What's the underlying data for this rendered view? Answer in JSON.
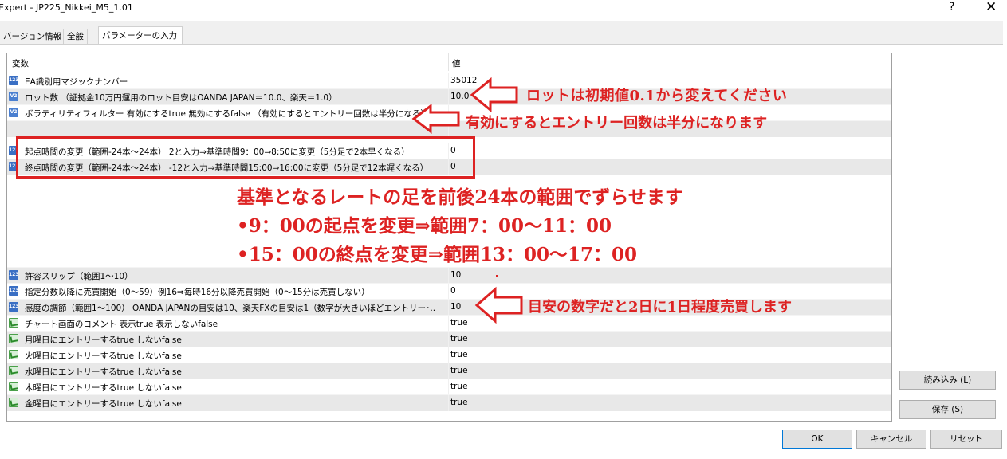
{
  "window": {
    "title": "Expert - JP225_Nikkei_M5_1.01",
    "help": "?",
    "close": "✕"
  },
  "tabs": [
    {
      "label": "バージョン情報"
    },
    {
      "label": "全般"
    },
    {
      "label": "パラメーターの入力"
    }
  ],
  "grid": {
    "headers": {
      "name": "変数",
      "value": "値"
    },
    "rows": [
      {
        "icon": "123",
        "name": "EA識別用マジックナンバー",
        "value": "35012"
      },
      {
        "icon": "V2",
        "name": "ロット数 （証拠金10万円運用のロット目安はOANDA JAPAN＝10.0、楽天＝1.0）",
        "value": "10.0"
      },
      {
        "icon": "V2",
        "name": "ボラティリティフィルター 有効にするtrue 無効にするfalse （有効にするとエントリー回数は半分になる）",
        "value": ""
      },
      {
        "icon": "",
        "name": "",
        "value": ""
      },
      {
        "icon": "123",
        "name": "起点時間の変更（範囲-24本～24本） 2と入力⇒基準時間9：00⇒8:50に変更（5分足で2本早くなる）",
        "value": "0"
      },
      {
        "icon": "123",
        "name": "終点時間の変更（範囲-24本～24本） -12と入力⇒基準時間15:00⇒16:00に変更（5分足で12本遅くなる）",
        "value": "0"
      },
      {
        "icon": "123",
        "name": "許容スリップ（範囲1～10）",
        "value": "10"
      },
      {
        "icon": "123",
        "name": "指定分数以降に売買開始（0～59）例16⇒毎時16分以降売買開始（0～15分は売買しない）",
        "value": "0"
      },
      {
        "icon": "123",
        "name": "感度の調節（範囲1～100） OANDA JAPANの目安は10、楽天FXの目安は1（数字が大きいほどエントリー･..",
        "value": "10"
      },
      {
        "icon": "bool",
        "name": "チャート画面のコメント 表示true 表示しないfalse",
        "value": "true"
      },
      {
        "icon": "bool",
        "name": "月曜日にエントリーするtrue しないfalse",
        "value": "true"
      },
      {
        "icon": "bool",
        "name": "火曜日にエントリーするtrue しないfalse",
        "value": "true"
      },
      {
        "icon": "bool",
        "name": "水曜日にエントリーするtrue しないfalse",
        "value": "true"
      },
      {
        "icon": "bool",
        "name": "木曜日にエントリーするtrue しないfalse",
        "value": "true"
      },
      {
        "icon": "bool",
        "name": "金曜日にエントリーするtrue しないfalse",
        "value": "true"
      }
    ]
  },
  "buttons": {
    "load": "読み込み (L)",
    "save": "保存 (S)",
    "ok": "OK",
    "cancel": "キャンセル",
    "reset": "リセット"
  },
  "annotations": {
    "lot": "ロットは初期値0.1から変えてください",
    "vol": "有効にするとエントリー回数は半分になります",
    "range1": "基準となるレートの足を前後24本の範囲でずらせます",
    "range2": "•9：00の起点を変更⇒範囲7：00～11：00",
    "range3": "•15：00の終点を変更⇒範囲13：00～17：00",
    "sens": "目安の数字だと2日に1日程度売買します"
  },
  "colors": {
    "annotation": "#dd2222",
    "selectedRow": "#e8e8e8"
  }
}
